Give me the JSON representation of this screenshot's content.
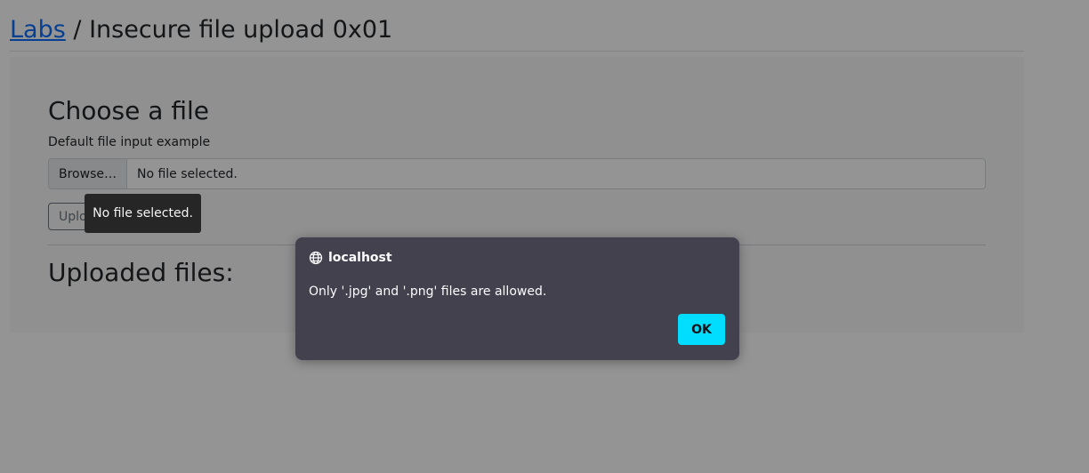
{
  "breadcrumb": {
    "link": "Labs",
    "separator": " / ",
    "title": "Insecure file upload 0x01"
  },
  "upload_card": {
    "heading": "Choose a file",
    "input_label": "Default file input example",
    "browse_label": "Browse…",
    "file_status": "No file selected.",
    "upload_label": "Upload",
    "uploaded_heading": "Uploaded files:"
  },
  "tooltip": {
    "text": "No file selected."
  },
  "dialog": {
    "origin": "localhost",
    "icon": "globe-icon",
    "message": "Only '.jpg' and '.png' files are allowed.",
    "ok_label": "OK",
    "accent": "#00ddff"
  }
}
